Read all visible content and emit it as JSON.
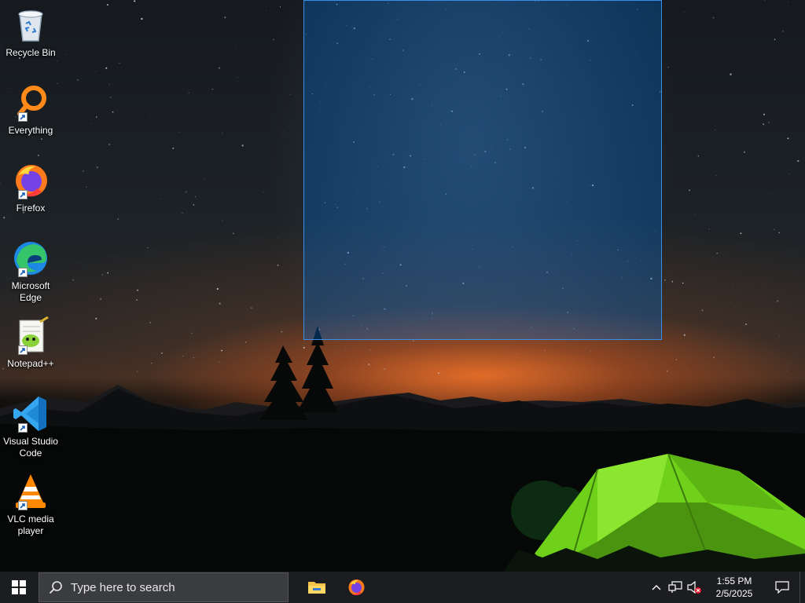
{
  "desktop": {
    "icons": [
      {
        "label": "Recycle Bin",
        "icon": "recycle-bin-icon"
      },
      {
        "label": "Everything",
        "icon": "everything-search-icon"
      },
      {
        "label": "Firefox",
        "icon": "firefox-icon"
      },
      {
        "label": "Microsoft Edge",
        "icon": "edge-icon"
      },
      {
        "label": "Notepad++",
        "icon": "notepad-plus-plus-icon"
      },
      {
        "label": "Visual Studio Code",
        "icon": "vscode-icon"
      },
      {
        "label": "VLC media player",
        "icon": "vlc-icon"
      }
    ]
  },
  "taskbar": {
    "search_placeholder": "Type here to search",
    "pinned": [
      {
        "name": "File Explorer",
        "icon": "file-explorer-icon"
      },
      {
        "name": "Firefox",
        "icon": "firefox-icon"
      }
    ],
    "tray": {
      "time": "1:55 PM",
      "date": "2/5/2025",
      "icons": [
        "chevron-up-icon",
        "network-icon",
        "volume-muted-icon"
      ]
    }
  },
  "colors": {
    "taskbar_bg": "#1c1d20",
    "selection_fill": "#0066cc",
    "selection_border": "#3a8ee6"
  }
}
